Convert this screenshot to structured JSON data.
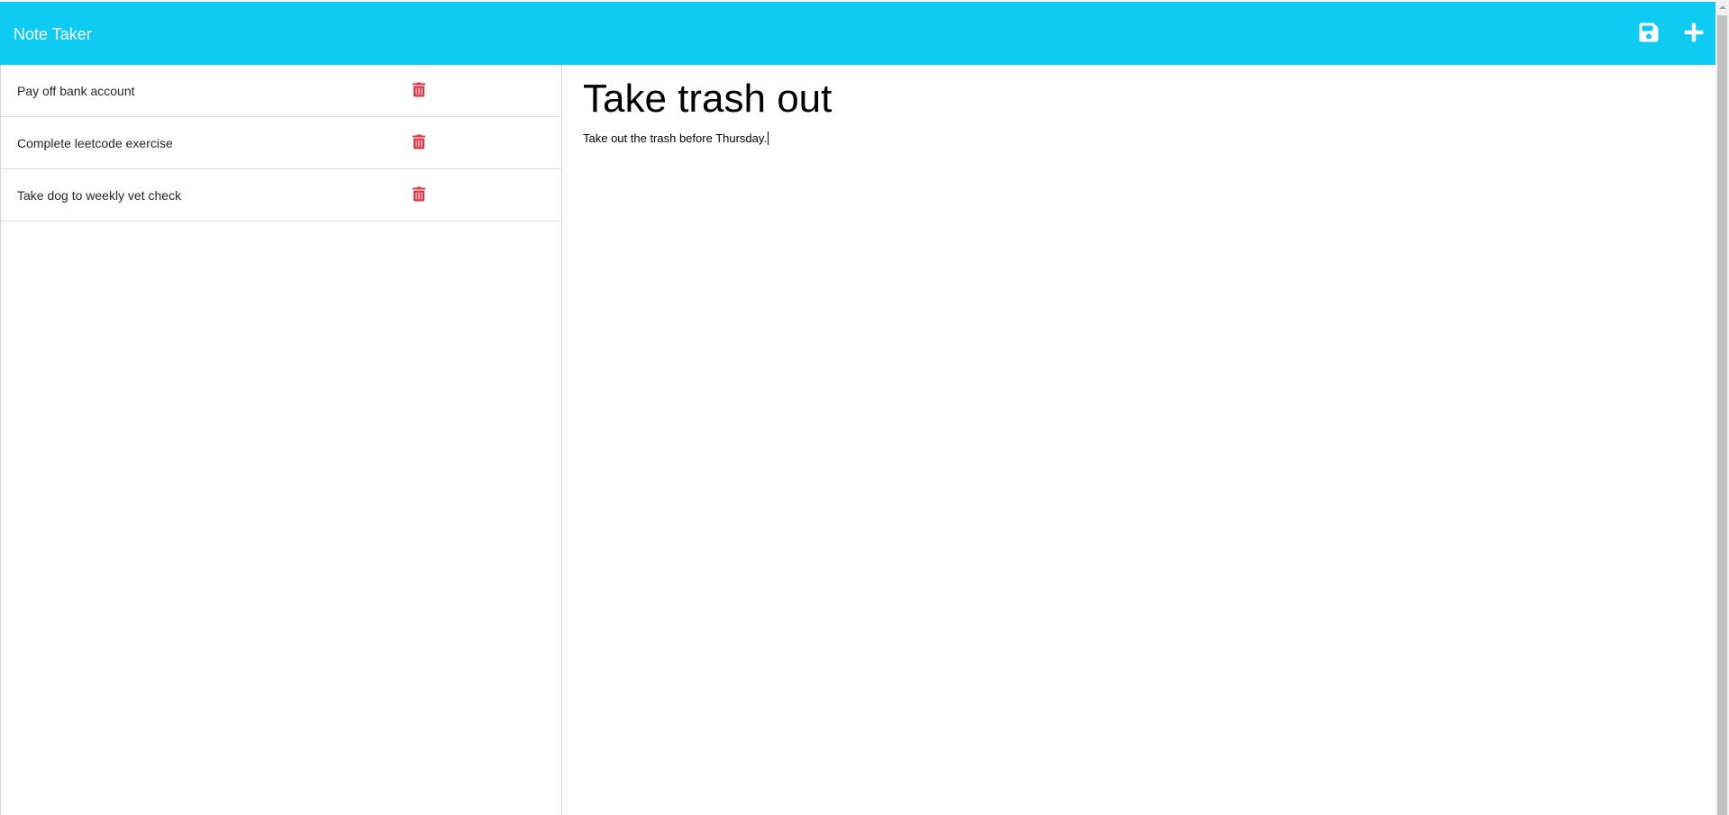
{
  "app": {
    "title": "Note Taker"
  },
  "navbar": {
    "save_icon": "save-icon",
    "new_icon": "plus-icon",
    "background_color": "#0ecbf2"
  },
  "sidebar": {
    "notes": [
      {
        "title": "Pay off bank account",
        "delete_icon": "trash-icon"
      },
      {
        "title": "Complete leetcode exercise",
        "delete_icon": "trash-icon"
      },
      {
        "title": "Take dog to weekly vet check",
        "delete_icon": "trash-icon"
      }
    ],
    "delete_color": "#dc3545"
  },
  "editor": {
    "title": "Take trash out",
    "body": "Take out the trash before Thursday."
  }
}
